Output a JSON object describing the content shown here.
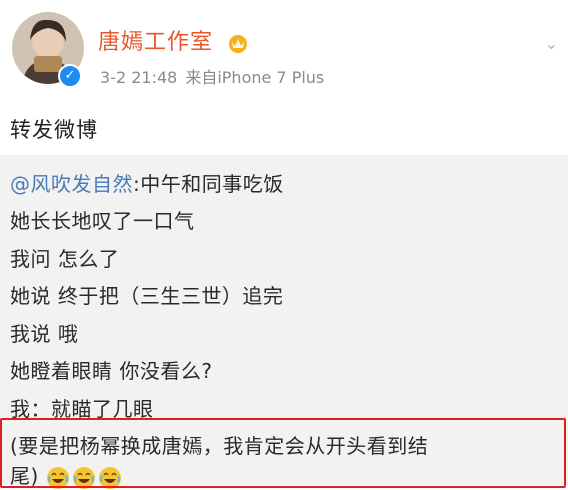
{
  "author": {
    "name": "唐嫣工作室",
    "time": "3-2 21:48",
    "source": "来自iPhone 7 Plus",
    "verified": true
  },
  "post": {
    "text": "转发微博"
  },
  "repost": {
    "mention": "@风吹发自然",
    "first_line_rest": ":中午和同事吃饭",
    "lines": [
      "她长长地叹了一口气",
      "我问 怎么了",
      "她说 终于把（三生三世）追完",
      "我说 哦",
      "她瞪着眼睛 你没看么?",
      "我：就瞄了几眼",
      "(要是把杨幂换成唐嫣，我肯定会从开头看到结",
      "尾)"
    ],
    "emojis": [
      "laugh-cry-emoji",
      "laugh-cry-emoji",
      "laugh-cry-emoji"
    ]
  },
  "colors": {
    "name": "#e8562c",
    "mention": "#4a7bb7",
    "highlight_border": "#e02020",
    "repost_bg": "#f2f2f2"
  }
}
